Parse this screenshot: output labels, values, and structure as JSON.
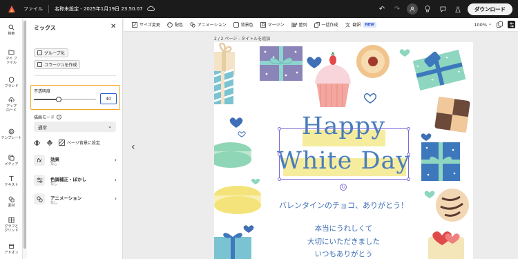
{
  "topbar": {
    "file_label": "ファイル",
    "doc_title": "名称未設定 - 2025年1月19日 23.50.07",
    "download_label": "ダウンロード"
  },
  "rail": {
    "items": [
      {
        "label": "検索",
        "icon": "search-icon"
      },
      {
        "label": "マイ ファイル",
        "icon": "folder-icon"
      },
      {
        "label": "ブランド",
        "icon": "brand-icon"
      },
      {
        "label": "アップ ロード",
        "icon": "upload-icon"
      },
      {
        "label": "テンプレート",
        "icon": "template-icon"
      },
      {
        "label": "メディア",
        "icon": "media-icon"
      },
      {
        "label": "テキスト",
        "icon": "text-icon"
      },
      {
        "label": "素材",
        "icon": "elements-icon"
      },
      {
        "label": "グラフと グリッド",
        "icon": "grid-icon"
      },
      {
        "label": "アドオン",
        "icon": "addon-icon"
      }
    ]
  },
  "panel": {
    "title": "ミックス",
    "group_button": "グループ化",
    "collage_button": "コラージュを作成",
    "opacity_label": "不透明度",
    "opacity_value": "40",
    "opacity_fraction": 0.4,
    "blend_label": "描画モード",
    "blend_value": "通常",
    "page_bg_label": "ページ背景に設定",
    "sections": [
      {
        "title": "効果",
        "sub": "なし",
        "icon": "fx-icon"
      },
      {
        "title": "色調補正・ぼかし",
        "sub": "なし",
        "icon": "adjust-icon"
      },
      {
        "title": "アニメーション",
        "sub": "なし",
        "icon": "animation-icon"
      }
    ]
  },
  "toolbar": {
    "resize": "サイズ変更",
    "color": "配色",
    "animation": "アニメーション",
    "background": "背景色",
    "margin": "マージン",
    "arrange": "整列",
    "batch": "一括作成",
    "translate": "翻訳",
    "new_badge": "NEW",
    "zoom": "100%"
  },
  "canvas": {
    "page_label": "2 / 2 ページ - タイトルを追加",
    "headline_1": "Happy",
    "headline_2": "White Day",
    "line_1": "バレンタインのチョコ、ありがとう！",
    "line_2": "本当にうれしくて",
    "line_3": "大切にいただきました",
    "line_4": "いつもありがとう",
    "colors": {
      "text_blue": "#4a7dbb",
      "highlight_yellow": "#f6ec9e",
      "selection": "#7a6bd8",
      "accent_orange": "#f5a623"
    }
  }
}
